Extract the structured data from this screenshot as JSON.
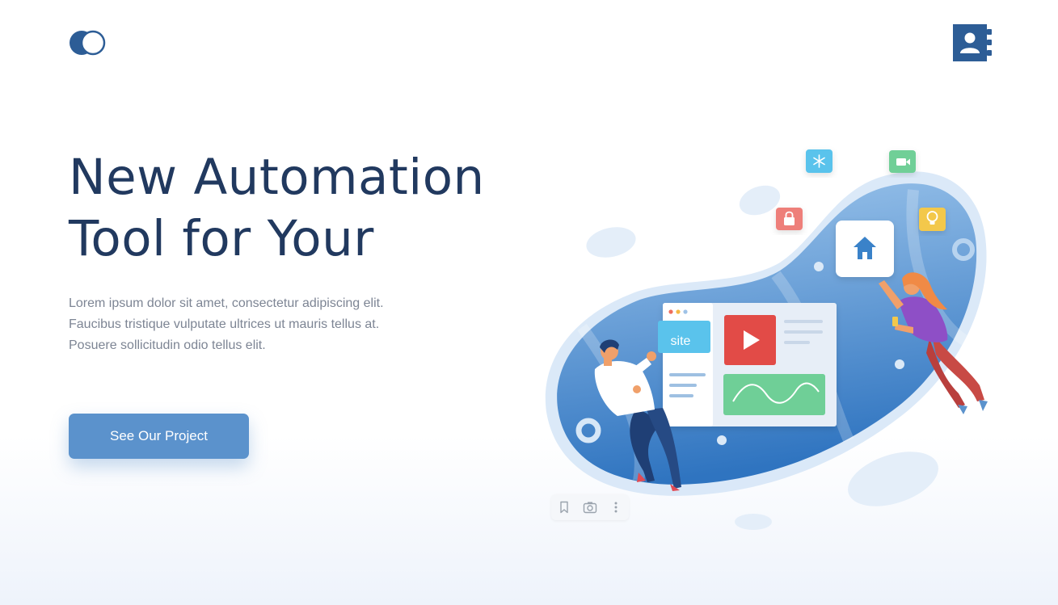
{
  "hero": {
    "title_line1": "New Automation",
    "title_line2": "Tool for Your",
    "description": "Lorem ipsum dolor sit amet, consectetur adipiscing elit. Faucibus tristique vulputate ultrices ut mauris tellus at. Posuere sollicitudin odio tellus elit.",
    "cta_label": "See Our Project"
  },
  "illustration": {
    "card_label": "site"
  },
  "icons": {
    "logo": "overlapping-circles-logo",
    "contact": "contact-book-icon",
    "toolbar": [
      "bookmark-icon",
      "camera-icon",
      "more-vertical-icon"
    ],
    "floating": [
      "snowflake-icon",
      "video-camera-icon",
      "lock-icon",
      "lightbulb-icon",
      "home-icon",
      "play-icon"
    ]
  },
  "colors": {
    "primary": "#5b92cc",
    "heading": "#21395f",
    "body_text": "#7d8594",
    "navy": "#2d5d96"
  }
}
